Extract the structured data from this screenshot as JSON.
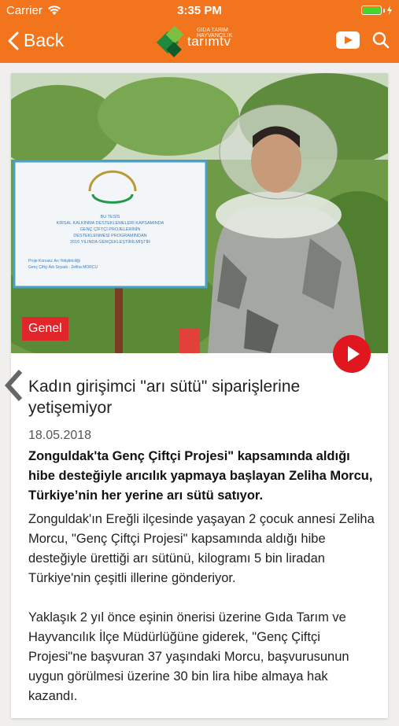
{
  "status_bar": {
    "carrier": "Carrier",
    "time": "3:35 PM"
  },
  "nav": {
    "back_label": "Back",
    "logo_text": "tarımtv",
    "logo_small": "GIDA TARIM HAYVANCILIK"
  },
  "article": {
    "category": "Genel",
    "title": "Kadın girişimci \"arı sütü\" siparişlerine yetişemiyor",
    "date": "18.05.2018",
    "lead": "Zonguldak'ta Genç Çiftçi Projesi\" kapsamında aldığı hibe desteğiyle arıcılık yapmaya başlayan Zeliha Morcu, Türkiye’nin her yerine arı sütü satıyor.",
    "paragraphs": [
      "Zonguldak'ın Ereğli ilçesinde yaşayan 2 çocuk annesi Zeliha Morcu, \"Genç Çiftçi Projesi\" kapsamında aldığı hibe desteğiyle ürettiği arı sütünü, kilogramı 5 bin liradan Türkiye'nin çeşitli illerine gönderiyor.",
      "Yaklaşık 2 yıl önce eşinin önerisi üzerine Gıda Tarım ve Hayvancılık İlçe Müdürlüğüne giderek, \"Genç Çiftçi Projesi\"ne başvuran 37 yaşındaki Morcu, başvurusunun uygun görülmesi üzerine 30 bin lira hibe almaya hak kazandı."
    ]
  },
  "photo_sign": {
    "line1": "BU TESİS",
    "line2": "KIRSAL KALKINMA DESTEKLEMELERİ KAPSAMINDA",
    "line3": "GENÇ ÇİFTÇİ PROJELERİNİN",
    "line4": "DESTEKLENMESİ PROGRAMINDAN",
    "line5": "2016 YILINDA GERÇEKLEŞTİRİLMİŞTİR",
    "line6": "Proje Konusu: Arı Yetiştiriciliği",
    "line7": "Genç Çiftçi Adı Soyadı : Zeliha MORCU"
  },
  "colors": {
    "header": "#f2751e",
    "tag": "#e0262a",
    "play": "#e0171e"
  },
  "icons": [
    "wifi-icon",
    "battery-icon",
    "back-chevron-icon",
    "youtube-icon",
    "search-icon",
    "play-icon",
    "prev-arrow-icon"
  ]
}
